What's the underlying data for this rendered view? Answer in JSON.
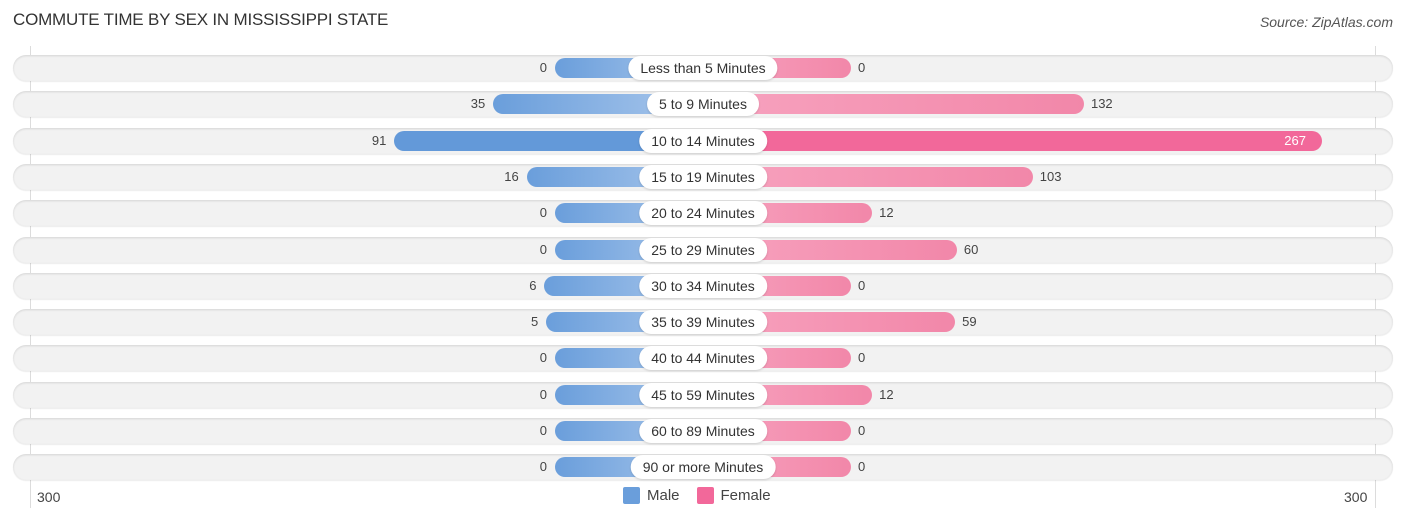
{
  "chart_data": {
    "type": "bar",
    "orientation": "horizontal-diverging",
    "title": "COMMUTE TIME BY SEX IN MISSISSIPPI STATE",
    "source": "Source: ZipAtlas.com",
    "categories": [
      "Less than 5 Minutes",
      "5 to 9 Minutes",
      "10 to 14 Minutes",
      "15 to 19 Minutes",
      "20 to 24 Minutes",
      "25 to 29 Minutes",
      "30 to 34 Minutes",
      "35 to 39 Minutes",
      "40 to 44 Minutes",
      "45 to 59 Minutes",
      "60 to 89 Minutes",
      "90 or more Minutes"
    ],
    "series": [
      {
        "name": "Male",
        "color": "#6a9edb",
        "values": [
          0,
          35,
          91,
          16,
          0,
          0,
          6,
          5,
          0,
          0,
          0,
          0
        ]
      },
      {
        "name": "Female",
        "color": "#f2689a",
        "values": [
          0,
          132,
          267,
          103,
          12,
          60,
          0,
          59,
          0,
          12,
          0,
          0
        ]
      }
    ],
    "axis": {
      "left_label": "300",
      "right_label": "300",
      "max": 300
    },
    "legend": {
      "position": "bottom-center",
      "items": [
        "Male",
        "Female"
      ]
    }
  }
}
